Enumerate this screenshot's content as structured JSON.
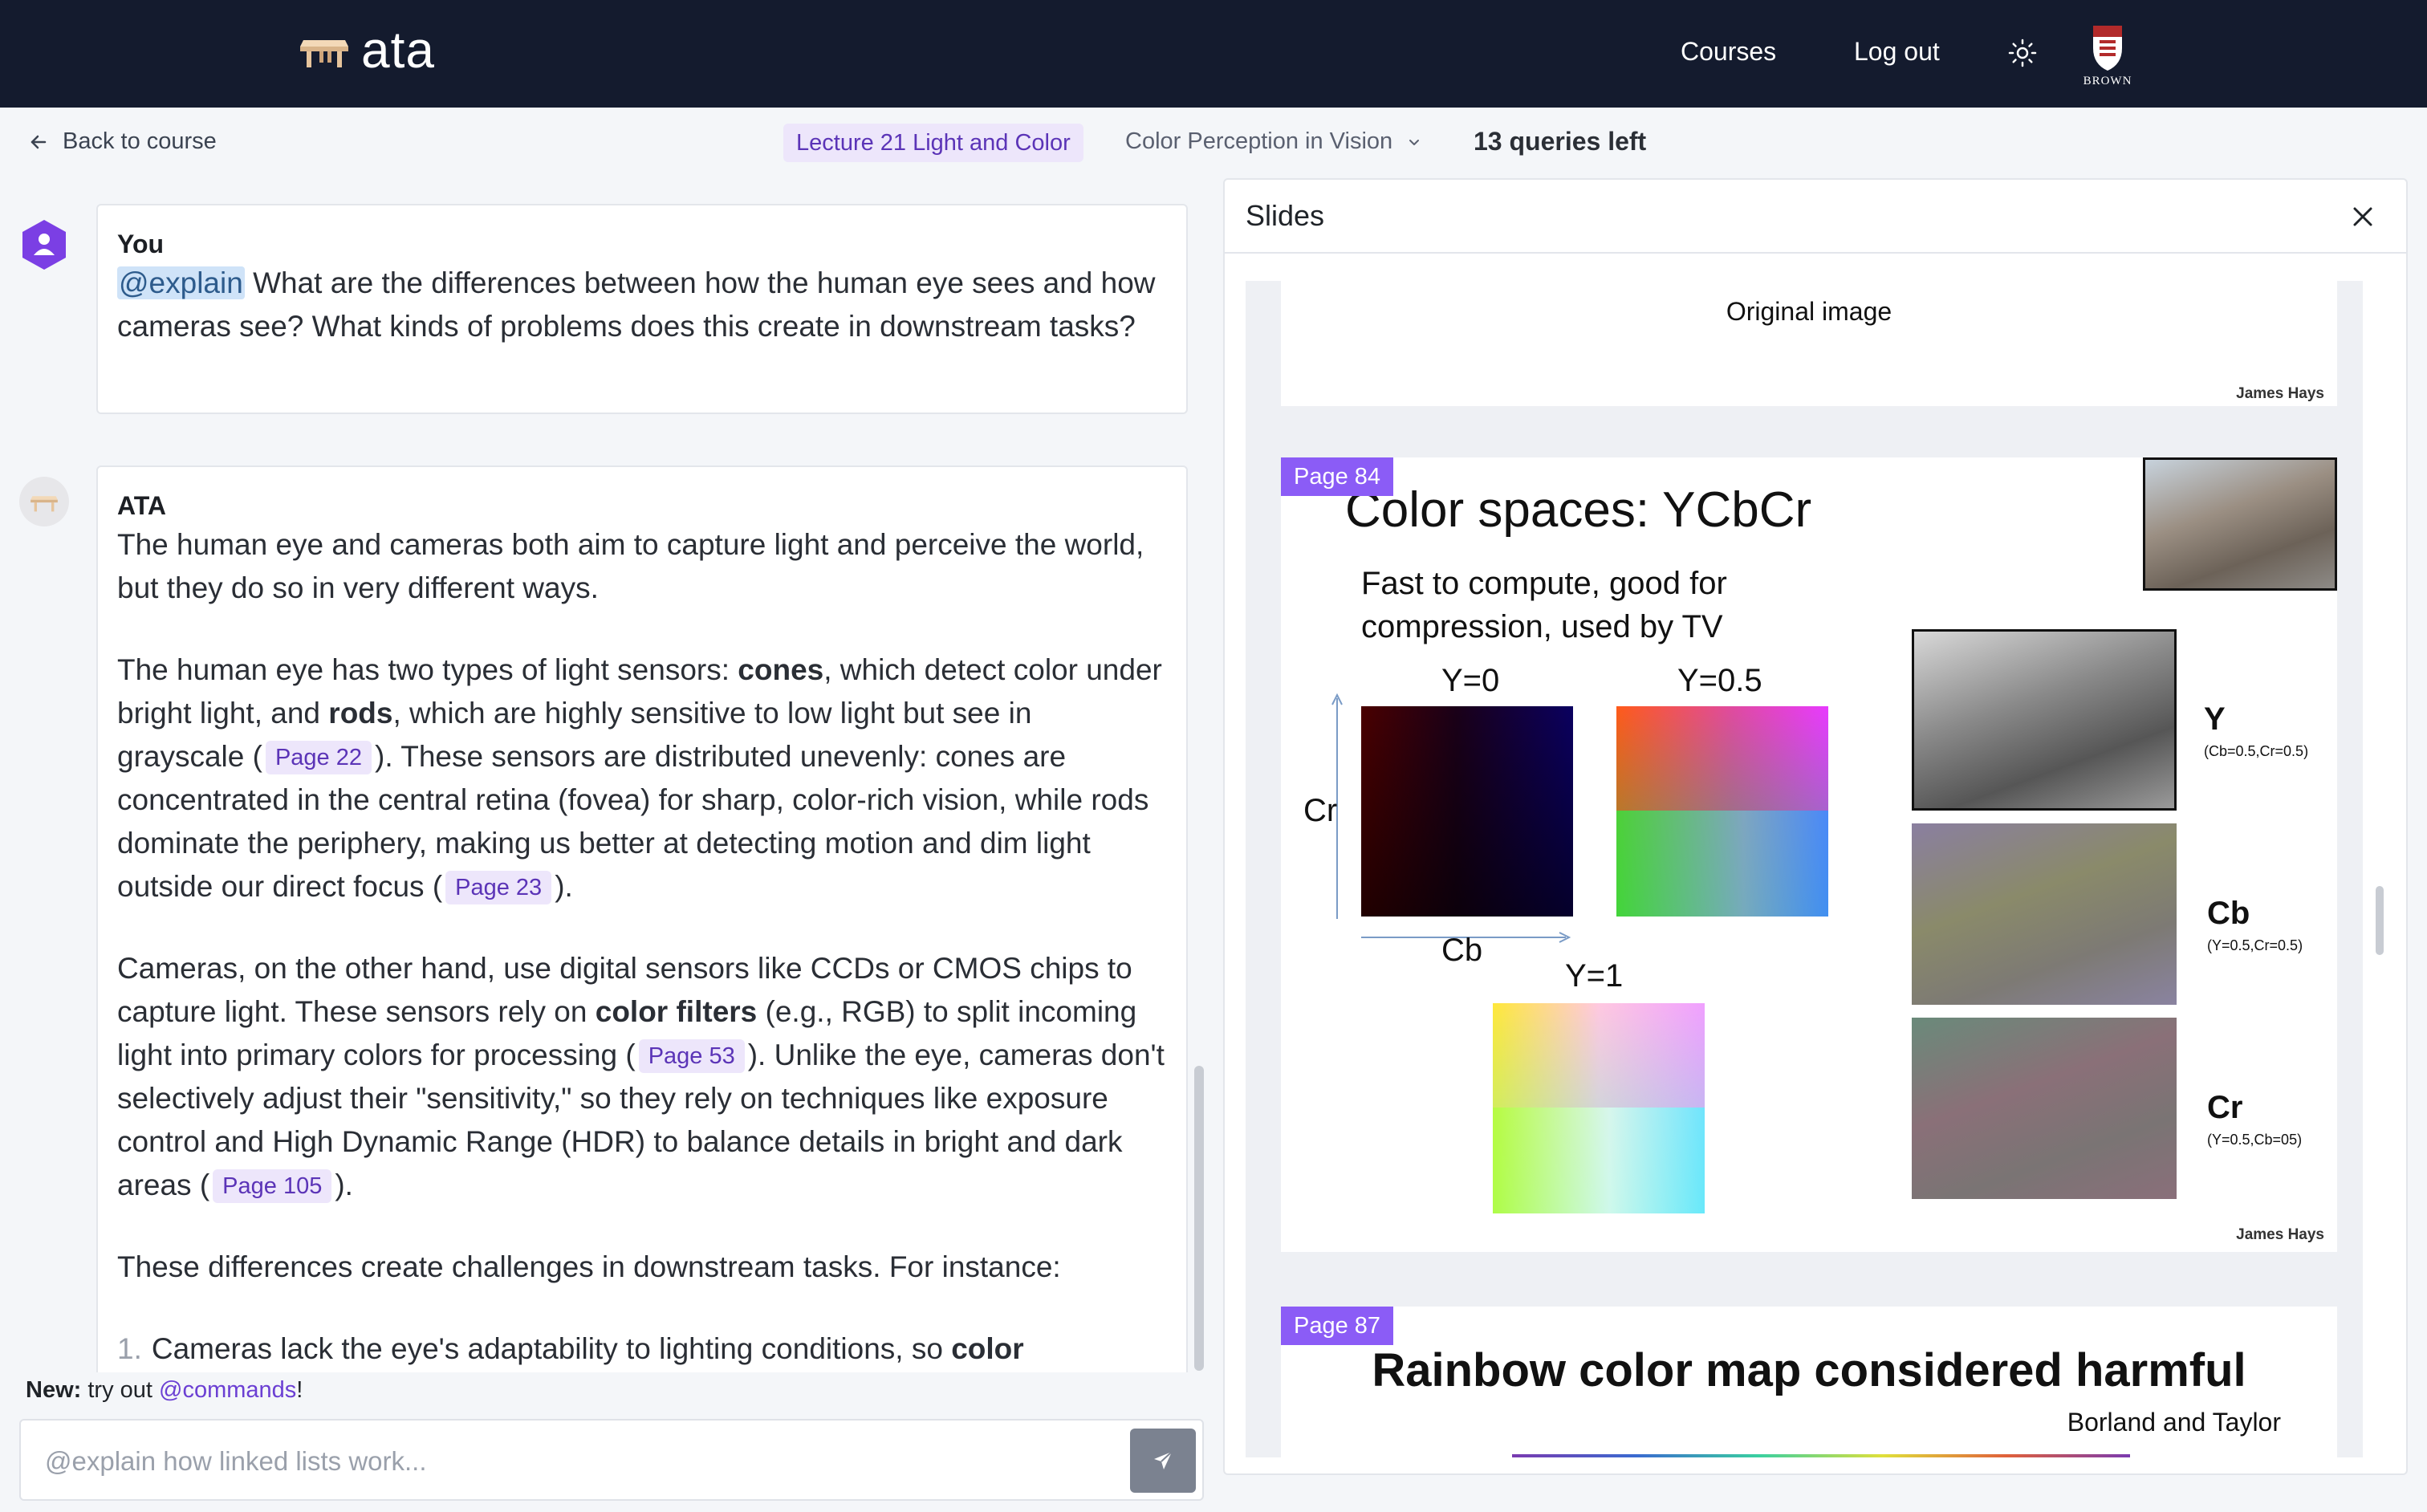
{
  "nav": {
    "logo_text": "ata",
    "courses": "Courses",
    "logout": "Log out",
    "school": "BROWN"
  },
  "subbar": {
    "back": "Back to course",
    "lecture": "Lecture 21 Light and Color",
    "topic": "Color Perception in Vision",
    "queries": "13 queries left"
  },
  "user_msg": {
    "sender": "You",
    "mention": "@explain",
    "text": " What are the differences between how the human eye sees and how cameras see? What kinds of problems does this create in downstream tasks?"
  },
  "ata_msg": {
    "sender": "ATA",
    "p1": "The human eye and cameras both aim to capture light and perceive the world, but they do so in very different ways.",
    "p2_a": "The human eye has two types of light sensors: ",
    "p2_b": "cones",
    "p2_c": ", which detect color under bright light, and ",
    "p2_d": "rods",
    "p2_e": ", which are highly sensitive to low light but see in grayscale (",
    "p2_chip1": "Page 22",
    "p2_f": "). These sensors are distributed unevenly: cones are concentrated in the central retina (fovea) for sharp, color-rich vision, while rods dominate the periphery, making us better at detecting motion and dim light outside our direct focus (",
    "p2_chip2": "Page 23",
    "p2_g": ").",
    "p3_a": "Cameras, on the other hand, use digital sensors like CCDs or CMOS chips to capture light. These sensors rely on ",
    "p3_b": "color filters",
    "p3_c": " (e.g., RGB) to split incoming light into primary colors for processing (",
    "p3_chip1": "Page 53",
    "p3_d": "). Unlike the eye, cameras don't selectively adjust their \"sensitivity,\" so they rely on techniques like exposure control and High Dynamic Range (HDR) to balance details in bright and dark areas (",
    "p3_chip2": "Page 105",
    "p3_e": ").",
    "p4": "These differences create challenges in downstream tasks. For instance:",
    "li1_num": "1.",
    "li1_a": "Cameras lack the eye's adaptability to lighting conditions, so ",
    "li1_b": "color"
  },
  "composer": {
    "new_label": "New:",
    "new_text": " try out ",
    "new_link": "@commands",
    "new_end": "!",
    "placeholder": "@explain how linked lists work..."
  },
  "slides": {
    "title": "Slides",
    "slide1": {
      "caption": "Original image",
      "credit": "James Hays"
    },
    "slide2": {
      "tag": "Page 84",
      "heading": "Color spaces: YCbCr",
      "sub1": "Fast to compute, good for",
      "sub2": "compression, used by TV",
      "y0": "Y=0",
      "y05": "Y=0.5",
      "y1": "Y=1",
      "cr_axis": "Cr",
      "cb_axis": "Cb",
      "Y_label": "Y",
      "Y_sub": "(Cb=0.5,Cr=0.5)",
      "Cb_label": "Cb",
      "Cb_sub": "(Y=0.5,Cr=0.5)",
      "Cr_label": "Cr",
      "Cr_sub": "(Y=0.5,Cb=05)",
      "credit": "James Hays"
    },
    "slide3": {
      "tag": "Page 87",
      "heading": "Rainbow color map considered harmful",
      "author": "Borland and Taylor"
    }
  },
  "colors": {
    "nav_bg": "#141b2e",
    "accent": "#8b5cf6",
    "chip_bg": "#ede6fb",
    "chip_text": "#5b34b7"
  }
}
